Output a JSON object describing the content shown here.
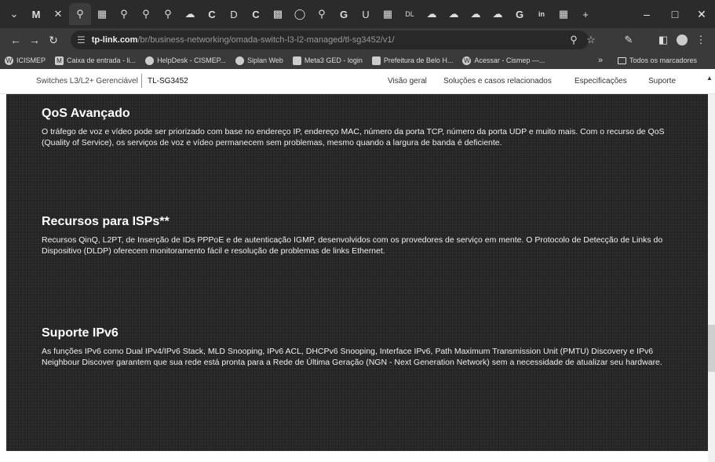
{
  "browser": {
    "tab_icons": [
      "chevron-down-icon",
      "gmail-icon",
      "close-icon",
      "tplink-icon",
      "table-icon",
      "tplink-icon",
      "tplink-icon",
      "tplink-icon",
      "cloud-icon",
      "c-icon",
      "d-icon",
      "c-icon",
      "doc-icon",
      "circle-icon",
      "tplink-icon",
      "google-icon",
      "u-icon",
      "grid-icon",
      "dl-icon",
      "cloud-icon",
      "cloud-icon",
      "cloud-icon",
      "cloud-icon",
      "google-icon",
      "linkedin-icon",
      "grid-icon"
    ],
    "new_tab": "+",
    "url_host": "tp-link.com",
    "url_path": "/br/business-networking/omada-switch-l3-l2-managed/tl-sg3452/v1/",
    "bookmarks": [
      {
        "label": "ICISMEP",
        "icon": "wordpress-icon"
      },
      {
        "label": "Caixa de entrada - li...",
        "icon": "gmail-icon"
      },
      {
        "label": "HelpDesk - CISMEP...",
        "icon": "globe-icon"
      },
      {
        "label": "Siplan Web",
        "icon": "globe-icon"
      },
      {
        "label": "Meta3 GED - login",
        "icon": "grid-icon"
      },
      {
        "label": "Prefeitura de Belo H...",
        "icon": "chart-icon"
      },
      {
        "label": "Acessar - Cismep —...",
        "icon": "wordpress-icon"
      }
    ],
    "bookmarks_overflow": "»",
    "all_bookmarks": "Todos os marcadores"
  },
  "subnav": {
    "breadcrumb": "Switches L3/L2+ Gerenciável",
    "model": "TL-SG3452",
    "links": [
      "Visão geral",
      "Soluções e casos relacionados",
      "Especificações",
      "Suporte"
    ]
  },
  "sections": [
    {
      "title": "QoS Avançado",
      "text": "O tráfego de voz e vídeo pode ser priorizado com base no endereço IP, endereço MAC, número da porta TCP, número da porta UDP e muito mais. Com o recurso de QoS (Quality of Service), os serviços de voz e vídeo permanecem sem problemas, mesmo quando a largura de banda é deficiente."
    },
    {
      "title": "Recursos para ISPs**",
      "text": "Recursos QinQ, L2PT, de Inserção de IDs PPPoE e de autenticação IGMP, desenvolvidos com os provedores de serviço em mente. O Protocolo de Detecção de Links do Dispositivo (DLDP) oferecem monitoramento fácil e resolução de problemas de links Ethernet."
    },
    {
      "title": "Suporte IPv6",
      "text": "As funções IPv6 como Dual IPv4/IPv6 Stack, MLD Snooping, IPv6 ACL, DHCPv6 Snooping, Interface IPv6, Path Maximum Transmission Unit (PMTU) Discovery e IPv6 Neighbour Discover garantem que sua rede está pronta para a Rede de Última Geração (NGN - Next Generation Network) sem a necessidade de atualizar seu hardware."
    }
  ]
}
